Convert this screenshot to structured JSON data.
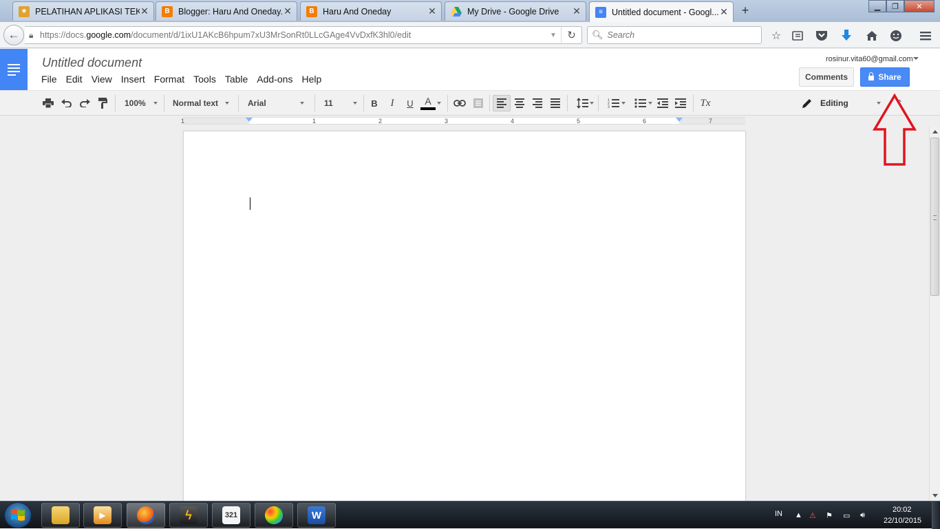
{
  "browser": {
    "tabs": [
      {
        "title": "PELATIHAN APLIKASI TEK...",
        "icon": "school-icon",
        "color": "#e0a32e"
      },
      {
        "title": "Blogger: Haru And Oneday...",
        "icon": "blogger-icon",
        "color": "#f57d00"
      },
      {
        "title": "Haru And Oneday",
        "icon": "blogger-icon",
        "color": "#f57d00"
      },
      {
        "title": "My Drive - Google Drive",
        "icon": "google-drive-icon",
        "color": "#1fa463"
      },
      {
        "title": "Untitled document - Googl...",
        "icon": "google-docs-icon",
        "color": "#4285f4"
      }
    ],
    "url_prefix": "https://docs.",
    "url_domain": "google.com",
    "url_path": "/document/d/1ixU1AKcB6hpum7xU3MrSonRt0LLcGAge4VvDxfK3hl0/edit",
    "search_placeholder": "Search"
  },
  "docs": {
    "title": "Untitled document",
    "menu": [
      "File",
      "Edit",
      "View",
      "Insert",
      "Format",
      "Tools",
      "Table",
      "Add-ons",
      "Help"
    ],
    "account": "rosinur.vita60@gmail.com",
    "comments_label": "Comments",
    "share_label": "Share",
    "accent_color": "#4285f4"
  },
  "toolbar": {
    "zoom": "100%",
    "style": "Normal text",
    "font": "Arial",
    "font_size": "11",
    "bold": "B",
    "italic": "I",
    "underline": "U",
    "text_color": "A",
    "clear_format": "Tx",
    "mode": "Editing"
  },
  "ruler": [
    "1",
    "1",
    "2",
    "3",
    "4",
    "5",
    "6",
    "7"
  ],
  "taskbar": {
    "apps": [
      {
        "name": "explorer-icon"
      },
      {
        "name": "media-player-icon"
      },
      {
        "name": "firefox-icon"
      },
      {
        "name": "winamp-icon"
      },
      {
        "name": "321-media-icon"
      },
      {
        "name": "paint-icon"
      },
      {
        "name": "word-icon"
      }
    ],
    "language": "IN",
    "time": "20:02",
    "date": "22/10/2015"
  }
}
